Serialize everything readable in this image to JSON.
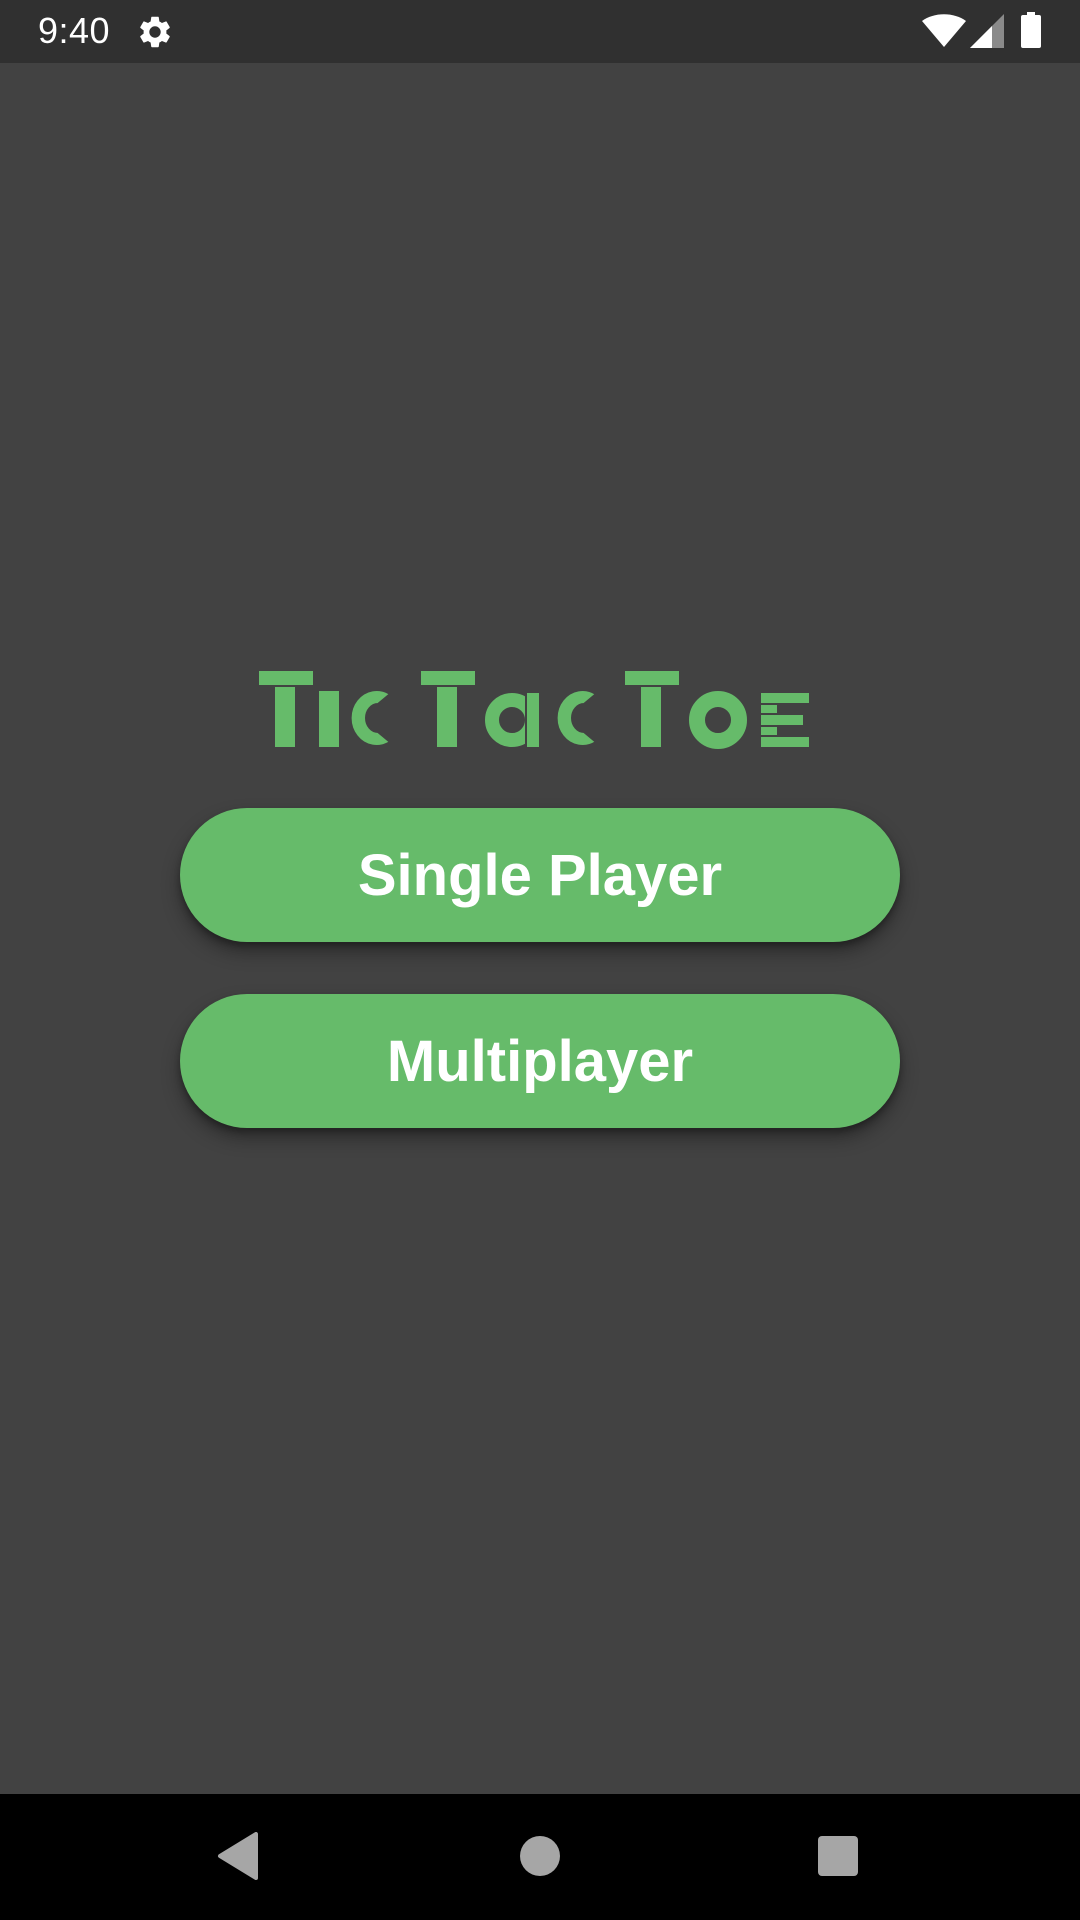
{
  "status_bar": {
    "time": "9:40",
    "icons": [
      "settings-icon",
      "wifi-icon",
      "cell-signal-icon",
      "battery-icon"
    ]
  },
  "app": {
    "title": "TicTacToe",
    "accent_color": "#66bb6a",
    "background_color": "#424242"
  },
  "menu": {
    "single_player_label": "Single Player",
    "multiplayer_label": "Multiplayer"
  },
  "nav_bar": {
    "icons": [
      "back-icon",
      "home-icon",
      "recents-icon"
    ]
  }
}
